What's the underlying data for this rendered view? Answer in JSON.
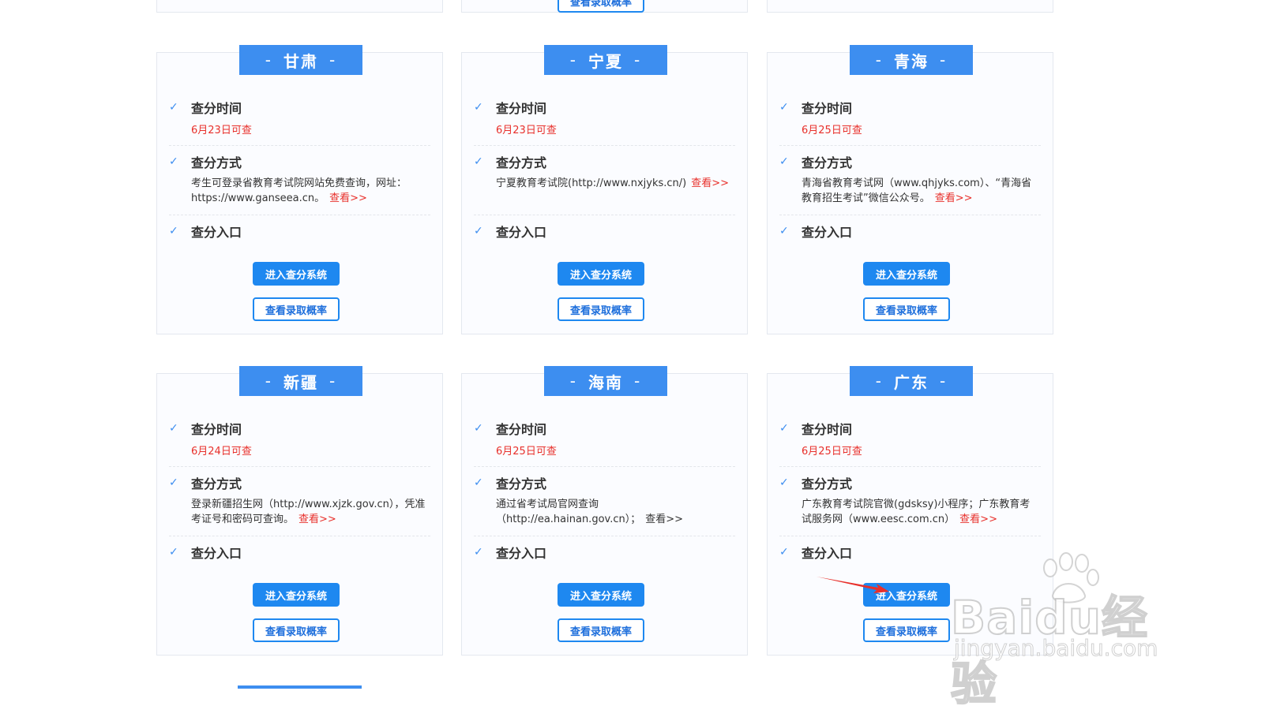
{
  "labels": {
    "time": "查分时间",
    "method": "查分方式",
    "entry": "查分入口",
    "enter_btn": "进入查分系统",
    "prob_btn": "查看录取概率",
    "view_more": "查看>>"
  },
  "top_row": {
    "peek_button": "查看录取概率"
  },
  "provinces": [
    {
      "name": "甘肃",
      "date": "6月23日可查",
      "method": "考生可登录省教育考试院网站免费查询，网址：https://www.ganseea.cn。"
    },
    {
      "name": "宁夏",
      "date": "6月23日可查",
      "method": "宁夏教育考试院(http://www.nxjyks.cn/)"
    },
    {
      "name": "青海",
      "date": "6月25日可查",
      "method": "青海省教育考试网（www.qhjyks.com）、“青海省教育招生考试”微信公众号。"
    },
    {
      "name": "新疆",
      "date": "6月24日可查",
      "method": "登录新疆招生网（http://www.xjzk.gov.cn），凭准考证号和密码可查询。"
    },
    {
      "name": "海南",
      "date": "6月25日可查",
      "method": "通过省考试局官网查询（http://ea.hainan.gov.cn）；"
    },
    {
      "name": "广东",
      "date": "6月25日可查",
      "method": "广东教育考试院官微(gdsksy)小程序；广东教育考试服务网（www.eesc.com.cn）"
    }
  ],
  "watermark": {
    "brand": "Baidu经验",
    "url": "jingyan.baidu.com"
  },
  "colors": {
    "accent": "#3d8ef0",
    "button": "#1e88f0",
    "date_red": "#e8302b"
  },
  "icons": {
    "check": "checkbox-check-icon",
    "arrow": "red-arrow-icon",
    "watermark": "baidu-paw-icon"
  }
}
